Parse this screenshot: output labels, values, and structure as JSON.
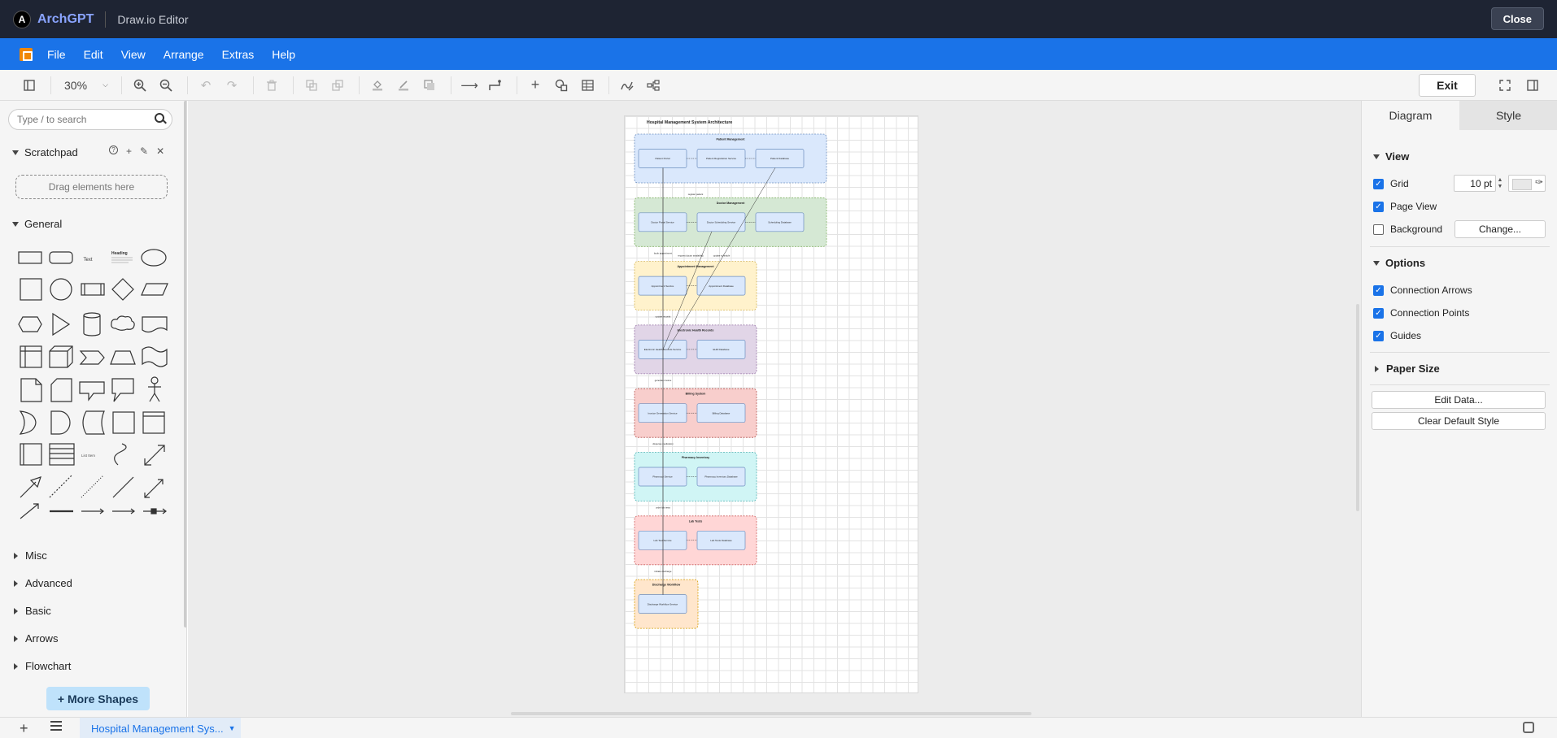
{
  "app": {
    "name": "ArchGPT",
    "subtitle": "Draw.io Editor",
    "close_label": "Close",
    "logo_glyph": "A"
  },
  "menu": {
    "items": [
      "File",
      "Edit",
      "View",
      "Arrange",
      "Extras",
      "Help"
    ]
  },
  "toolbar": {
    "zoom": "30%",
    "exit_label": "Exit"
  },
  "sidebar": {
    "search_placeholder": "Type / to search",
    "scratchpad_title": "Scratchpad",
    "dropzone_label": "Drag elements here",
    "general_title": "General",
    "collapsed_sections": [
      "Misc",
      "Advanced",
      "Basic",
      "Arrows",
      "Flowchart"
    ],
    "more_shapes_label": "+ More Shapes",
    "shape_labels": {
      "text": "Text",
      "heading": "Heading",
      "list": "List Item"
    }
  },
  "diagram": {
    "title": "Hospital Management System Architecture",
    "groups": [
      {
        "name": "Patient Management",
        "fill": "#dae8fc",
        "stroke": "#6c8ebf",
        "nodes": [
          "Patient Portal",
          "Patient Registration Service",
          "Patient Database"
        ]
      },
      {
        "name": "Doctor Management",
        "fill": "#d5e8d4",
        "stroke": "#82b366",
        "nodes": [
          "Doctor Portal Service",
          "Doctor Scheduling Service",
          "Scheduling Database"
        ]
      },
      {
        "name": "Appointment Management",
        "fill": "#fff2cc",
        "stroke": "#d6b656",
        "nodes": [
          "Appointment Service",
          "Appointment Database"
        ]
      },
      {
        "name": "Electronic Health Records",
        "fill": "#e1d5e7",
        "stroke": "#9673a6",
        "nodes": [
          "Electronic Health Records Service",
          "EHR Database"
        ]
      },
      {
        "name": "Billing System",
        "fill": "#f8cecc",
        "stroke": "#b85450",
        "nodes": [
          "Invoice Generation Service",
          "Billing Database"
        ]
      },
      {
        "name": "Pharmacy Inventory",
        "fill": "#d0f5f5",
        "stroke": "#4fb3b3",
        "nodes": [
          "Pharmacy Service",
          "Pharmacy Inventory Database"
        ]
      },
      {
        "name": "Lab Tests",
        "fill": "#ffd6d6",
        "stroke": "#d06060",
        "nodes": [
          "Lab Test Service",
          "Lab Tests Database"
        ]
      },
      {
        "name": "Discharge Workflow",
        "fill": "#ffe6cc",
        "stroke": "#d79b00",
        "nodes": [
          "Discharge Workflow Service"
        ]
      }
    ],
    "edge_labels": [
      "register patient",
      "request doctor availability",
      "update schedule",
      "book appointment",
      "update records",
      "generate invoice",
      "dispense medication",
      "order lab tests",
      "initiate discharge"
    ]
  },
  "rpanel": {
    "tab_diagram": "Diagram",
    "tab_style": "Style",
    "view_title": "View",
    "grid_label": "Grid",
    "grid_size": "10 pt",
    "page_view_label": "Page View",
    "background_label": "Background",
    "change_label": "Change...",
    "options_title": "Options",
    "connection_arrows_label": "Connection Arrows",
    "connection_points_label": "Connection Points",
    "guides_label": "Guides",
    "paper_size_title": "Paper Size",
    "edit_data_label": "Edit Data...",
    "clear_default_style_label": "Clear Default Style",
    "checkbox_states": {
      "grid": true,
      "page_view": true,
      "background": false,
      "connection_arrows": true,
      "connection_points": true,
      "guides": true
    }
  },
  "bottombar": {
    "page_tab_label": "Hospital Management Sys..."
  },
  "colors": {
    "appbar": "#1e2433",
    "menubar": "#1a73e8",
    "accent": "#1a73e8",
    "more_shapes": "#bfe2fb"
  }
}
